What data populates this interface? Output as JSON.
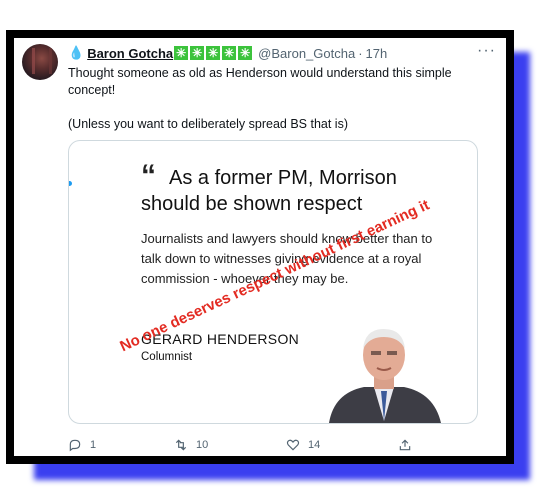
{
  "tweet": {
    "author_name": "Baron Gotcha",
    "handle": "@Baron_Gotcha",
    "separator": "·",
    "time": "17h",
    "badges": [
      "✳",
      "✳",
      "✳",
      "✳",
      "✳"
    ],
    "text_line1": "Thought someone as old as Henderson would understand this simple concept!",
    "text_line2": "(Unless you want to deliberately spread BS that is)",
    "more_label": "···"
  },
  "card": {
    "quote_mark": "“",
    "headline": "As a former PM, Morrison should be shown respect",
    "body": "Journalists and lawyers should know better than to talk down to witnesses giving evidence at a royal commission - whoever they may be.",
    "author": "GERARD HENDERSON",
    "role": "Columnist",
    "overlay": "No one deserves respect without first earning it"
  },
  "actions": {
    "reply_count": "1",
    "retweet_count": "10",
    "like_count": "14"
  },
  "colors": {
    "accent": "#1d9bf0",
    "badge": "#3cc33c",
    "overlay_text": "#e32b22",
    "frame": "#000000",
    "shadow": "#3a3ff0"
  }
}
